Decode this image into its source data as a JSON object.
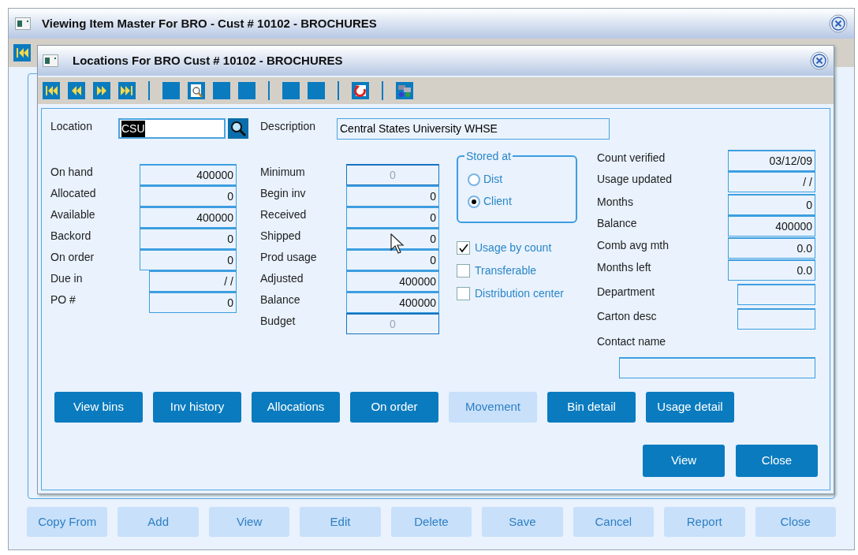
{
  "outer_window": {
    "title": "Viewing Item Master For BRO -  Cust # 10102 - BROCHURES",
    "buttons": [
      {
        "label": "Copy From",
        "disabled": true
      },
      {
        "label": "Add",
        "disabled": true
      },
      {
        "label": "View",
        "disabled": true
      },
      {
        "label": "Edit",
        "disabled": true
      },
      {
        "label": "Delete",
        "disabled": true
      },
      {
        "label": "Save",
        "disabled": true
      },
      {
        "label": "Cancel",
        "disabled": true
      },
      {
        "label": "Report",
        "disabled": true
      },
      {
        "label": "Close",
        "disabled": true
      }
    ]
  },
  "dialog": {
    "title": "Locations For BRO  Cust # 10102 - BROCHURES",
    "location": {
      "label": "Location",
      "value": "CSU",
      "text_selected": true
    },
    "description": {
      "label": "Description",
      "value": "Central States University WHSE"
    },
    "left_fields": [
      {
        "label": "On hand",
        "value": "400000",
        "kind": "wide"
      },
      {
        "label": "Allocated",
        "value": "0",
        "kind": "wide"
      },
      {
        "label": "Available",
        "value": "400000",
        "kind": "wide"
      },
      {
        "label": "Backord",
        "value": "0",
        "kind": "wide"
      },
      {
        "label": "On order",
        "value": "0",
        "kind": "wide"
      },
      {
        "label": "Due in",
        "value": "/ /",
        "kind": "narrow"
      },
      {
        "label": "PO #",
        "value": "0",
        "kind": "narrow"
      }
    ],
    "middle_fields": [
      {
        "label": "Minimum",
        "value": "0",
        "disabled": true
      },
      {
        "label": "Begin inv",
        "value": "0",
        "disabled": false
      },
      {
        "label": "Received",
        "value": "0",
        "disabled": false
      },
      {
        "label": "Shipped",
        "value": "0",
        "disabled": false
      },
      {
        "label": "Prod usage",
        "value": "0",
        "disabled": false
      },
      {
        "label": "Adjusted",
        "value": "400000",
        "disabled": false
      },
      {
        "label": "Balance",
        "value": "400000",
        "disabled": false
      },
      {
        "label": "Budget",
        "value": "0",
        "disabled": true
      }
    ],
    "stored_at": {
      "label": "Stored at",
      "options": [
        {
          "label": "Dist",
          "selected": false
        },
        {
          "label": "Client",
          "selected": true
        }
      ]
    },
    "checkboxes": [
      {
        "label": "Usage by count",
        "checked": true
      },
      {
        "label": "Transferable",
        "checked": false
      },
      {
        "label": "Distribution center",
        "checked": false
      }
    ],
    "right_fields": [
      {
        "label": "Count verified",
        "value": "03/12/09",
        "kind": "wide"
      },
      {
        "label": "Usage updated",
        "value": "/ /",
        "kind": "wide"
      },
      {
        "label": "Months",
        "value": "0",
        "kind": "wide"
      },
      {
        "label": "Balance",
        "value": "400000",
        "kind": "wide"
      },
      {
        "label": "Comb avg mth",
        "value": "0.0",
        "kind": "wide"
      },
      {
        "label": "Months left",
        "value": "0.0",
        "kind": "wide"
      },
      {
        "label": "Department",
        "kind": "narrow"
      },
      {
        "label": "Carton desc",
        "kind": "narrow"
      }
    ],
    "contact": {
      "label": "Contact name"
    },
    "action_buttons": [
      {
        "label": "View bins",
        "disabled": false
      },
      {
        "label": "Inv history",
        "disabled": false
      },
      {
        "label": "Allocations",
        "disabled": false
      },
      {
        "label": "On order",
        "disabled": false
      },
      {
        "label": "Movement",
        "disabled": true
      },
      {
        "label": "Bin detail",
        "disabled": false
      },
      {
        "label": "Usage detail",
        "disabled": false
      }
    ],
    "footer_buttons": [
      {
        "label": "View",
        "disabled": false
      },
      {
        "label": "Close",
        "disabled": false
      }
    ]
  }
}
